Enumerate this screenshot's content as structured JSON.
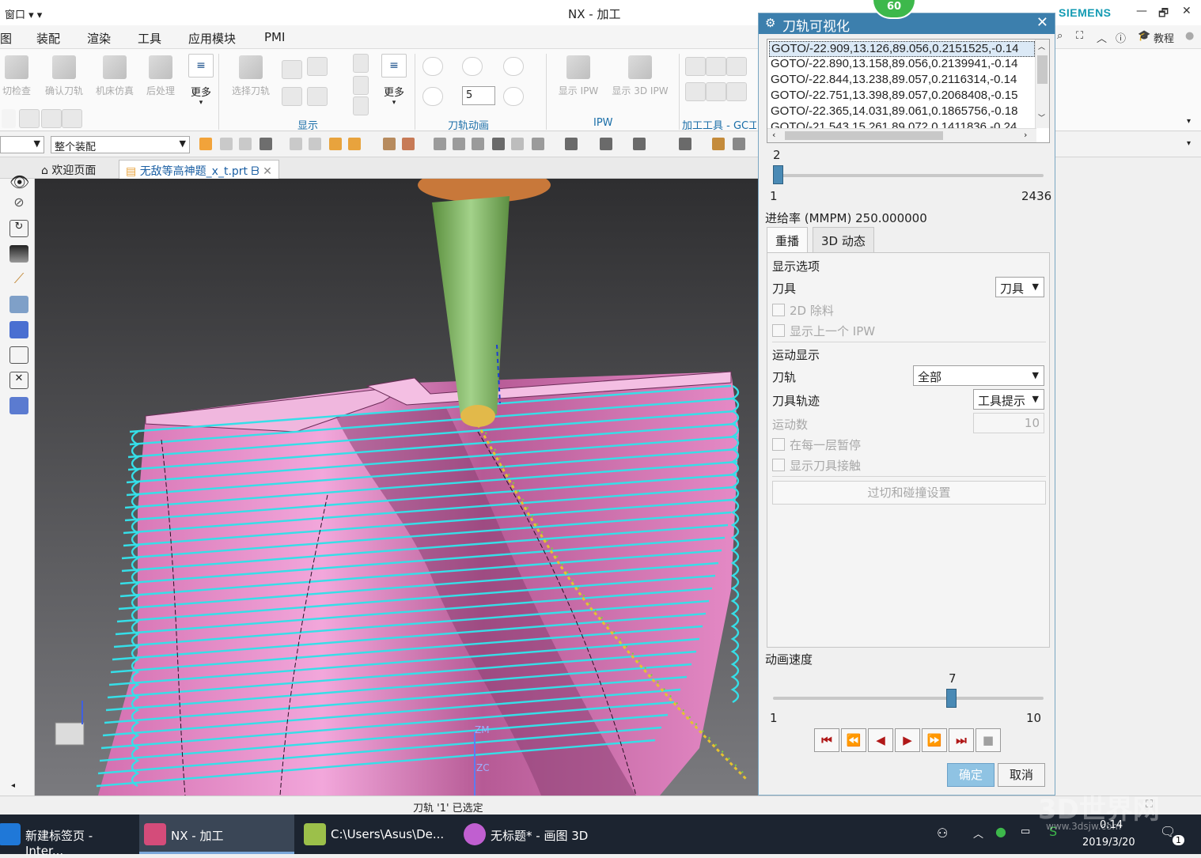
{
  "titlebar": {
    "window_menu": "窗口 ▾ ▾",
    "title": "NX - 加工",
    "brand": "SIEMENS",
    "min": "—",
    "restore": "🗗",
    "close": "✕"
  },
  "menubar": {
    "items": [
      "图",
      "装配",
      "渲染",
      "工具",
      "应用模块",
      "PMI"
    ],
    "tutorial": "教程"
  },
  "ribbon": {
    "buttons_left": [
      "切检查",
      "确认刀轨",
      "机床仿真",
      "后处理"
    ],
    "more1": "更多",
    "select_toolpath": "选择刀轨",
    "more2": "更多",
    "spin_value": "5",
    "show_ipw": "显示 IPW",
    "show_3d_ipw": "显示 3D IPW",
    "groups": [
      "显示",
      "刀轨动画",
      "IPW",
      "加工工具 - GC工"
    ]
  },
  "selection": {
    "filter_combo": "",
    "scope_combo": "整个装配"
  },
  "tabs": {
    "welcome": "欢迎页面",
    "part": "无敌等高神题_x_t.prt"
  },
  "viewport": {
    "labels": [
      "ZM",
      "ZC"
    ]
  },
  "status": {
    "message": "刀轨 '1' 已选定"
  },
  "taskbar": {
    "items": [
      "新建标签页 - Inter...",
      "NX - 加工",
      "C:\\Users\\Asus\\De...",
      "无标题* - 画图 3D"
    ],
    "time": "0:14",
    "date": "2019/3/20",
    "notif": "1",
    "watermark": "3D世界网",
    "watermark_url": "www.3dsjw.com"
  },
  "dialog": {
    "badge": "60",
    "title": "刀轨可视化",
    "goto_lines": [
      "GOTO/-22.909,13.126,89.056,0.2151525,-0.14",
      "GOTO/-22.890,13.158,89.056,0.2139941,-0.14",
      "GOTO/-22.844,13.238,89.057,0.2116314,-0.14",
      "GOTO/-22.751,13.398,89.057,0.2068408,-0.15",
      "GOTO/-22.365,14.031,89.061,0.1865756,-0.18",
      "GOTO/-21.543,15.261,89.072,0.1411836,-0.24"
    ],
    "slider1": {
      "value": "2",
      "min": "1",
      "max": "2436",
      "position": 0.0004
    },
    "feed_rate": "进给率 (MMPM) 250.000000",
    "tab_replay": "重播",
    "tab_3d": "3D 动态",
    "section_display": "显示选项",
    "tool_label": "刀具",
    "tool_value": "刀具",
    "chk_2d": "2D 除料",
    "chk_prev_ipw": "显示上一个 IPW",
    "section_motion": "运动显示",
    "path_label": "刀轨",
    "path_value": "全部",
    "trace_label": "刀具轨迹",
    "trace_value": "工具提示",
    "motions_label": "运动数",
    "motions_value": "10",
    "chk_pause": "在每一层暂停",
    "chk_contact": "显示刀具接触",
    "gouge_button": "过切和碰撞设置",
    "anim_speed": "动画速度",
    "slider2": {
      "value": "7",
      "min": "1",
      "max": "10",
      "position": 0.667
    },
    "ok": "确定",
    "cancel": "取消"
  }
}
